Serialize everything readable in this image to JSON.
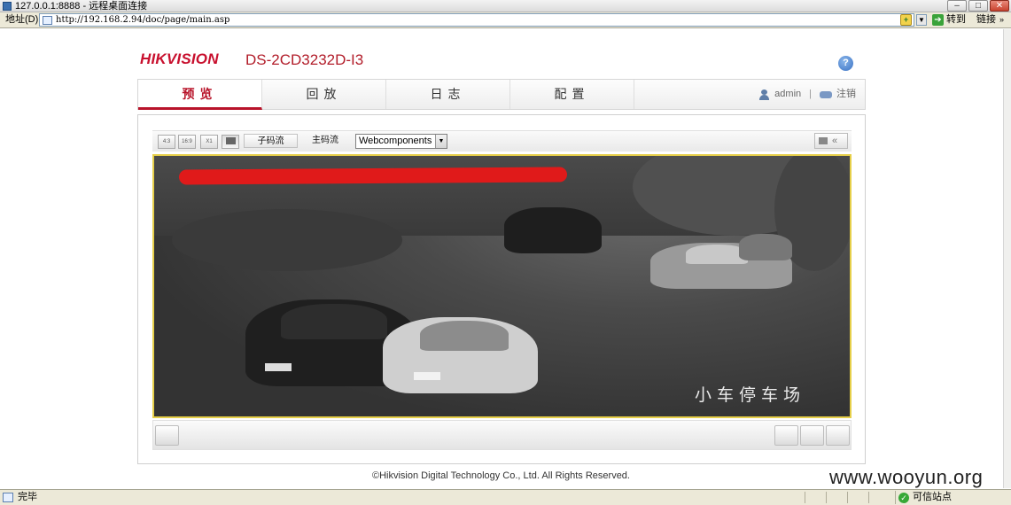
{
  "window": {
    "title": "127.0.0.1:8888 - 远程桌面连接"
  },
  "browser": {
    "address_label": "地址(D)",
    "url": "http://192.168.2.94/doc/page/main.asp",
    "go_label": "转到",
    "links_label": "链接",
    "status_text": "完毕",
    "zone_text": "可信站点"
  },
  "header": {
    "logo": "HIKVISION",
    "model": "DS-2CD3232D-I3"
  },
  "nav": {
    "tabs": [
      "预览",
      "回放",
      "日志",
      "配置"
    ],
    "active_tab": "预览",
    "username": "admin",
    "logout_label": "注销"
  },
  "toolbar": {
    "ratio_buttons": [
      "4:3",
      "16:9",
      "X1",
      "full"
    ],
    "sub_stream_label": "子码流",
    "main_stream_label": "主码流",
    "plugin_value": "Webcomponents",
    "ptz_toggle_label": "«"
  },
  "video": {
    "osd_text": "小车停车场"
  },
  "footer": {
    "copyright": "©Hikvision Digital Technology Co., Ltd. All Rights Reserved."
  },
  "watermark": "www.wooyun.org",
  "colors": {
    "brand_red": "#c8102e",
    "video_border": "#e6cf49",
    "redaction": "#e01a1a"
  }
}
